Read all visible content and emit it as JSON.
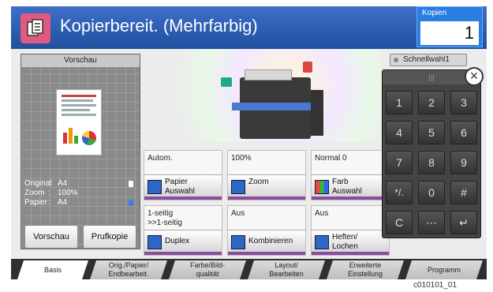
{
  "title": "Kopierbereit. (Mehrfarbig)",
  "app_icon": "copy-icon",
  "kopien": {
    "label": "Kopien",
    "value": "1"
  },
  "preview": {
    "header": "Vorschau",
    "original_label": "Original",
    "original_value": "A4",
    "zoom_label": "Zoom",
    "zoom_value": "100%",
    "paper_label": "Papier",
    "paper_value": "A4",
    "preview_button": "Vorschau",
    "proof_button": "Prufkopie"
  },
  "settings": [
    {
      "value": "Autom.",
      "label": "Papier\nAuswahl",
      "icon": "paper-icon"
    },
    {
      "value": "100%",
      "label": "Zoom",
      "icon": "zoom-icon"
    },
    {
      "value": "Normal 0",
      "label": "Farb\nAuswahl",
      "icon": "color-icon"
    },
    {
      "value": "1-seitig\n>>1-seitig",
      "label": "Duplex",
      "icon": "duplex-icon"
    },
    {
      "value": "Aus",
      "label": "Kombinieren",
      "icon": "combine-icon"
    },
    {
      "value": "Aus",
      "label": "Heften/\nLochen",
      "icon": "staple-icon"
    }
  ],
  "quick_setup": "Schnellwahl1",
  "keypad": {
    "keys": [
      "1",
      "2",
      "3",
      "4",
      "5",
      "6",
      "7",
      "8",
      "9",
      "*/.",
      "0",
      "#",
      "C",
      "⋯",
      "↵"
    ]
  },
  "tabs": [
    {
      "label": "Basis",
      "active": true
    },
    {
      "label": "Orig./Papier/\nEndbearbeit.",
      "active": false
    },
    {
      "label": "Farbe/Bild-\nqualität",
      "active": false
    },
    {
      "label": "Layout/\nBearbeiten",
      "active": false
    },
    {
      "label": "Erweiterte\nEinstellung",
      "active": false
    },
    {
      "label": "Programm",
      "active": false
    }
  ],
  "caption": "c010101_01"
}
